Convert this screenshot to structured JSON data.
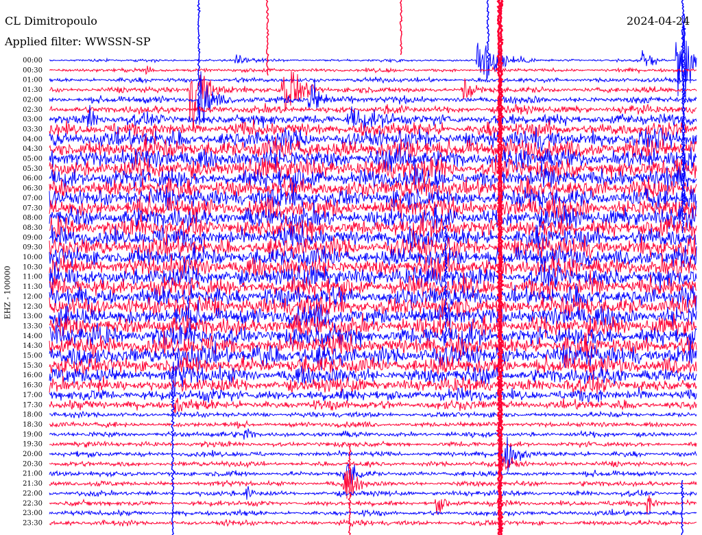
{
  "header": {
    "station": "CL Dimitropoulo",
    "filter": "Applied filter: WWSSN-SP",
    "date": "2024-04-24"
  },
  "chart_data": {
    "type": "helicorder",
    "ylabel": "EHZ - 100000",
    "row_labels": [
      "00:00",
      "00:30",
      "01:00",
      "01:30",
      "02:00",
      "02:30",
      "03:00",
      "03:30",
      "04:00",
      "04:30",
      "05:00",
      "05:30",
      "06:00",
      "06:30",
      "07:00",
      "07:30",
      "08:00",
      "08:30",
      "09:00",
      "09:30",
      "10:00",
      "10:30",
      "11:00",
      "11:30",
      "12:00",
      "12:30",
      "13:00",
      "13:30",
      "14:00",
      "14:30",
      "15:00",
      "15:30",
      "16:00",
      "16:30",
      "17:00",
      "17:30",
      "18:00",
      "18:30",
      "19:00",
      "19:30",
      "20:00",
      "20:30",
      "21:00",
      "21:30",
      "22:00",
      "22:30",
      "23:00",
      "23:30"
    ],
    "trace_colors": [
      "#0000ff",
      "#ff0033"
    ],
    "background": "#ffffff"
  }
}
